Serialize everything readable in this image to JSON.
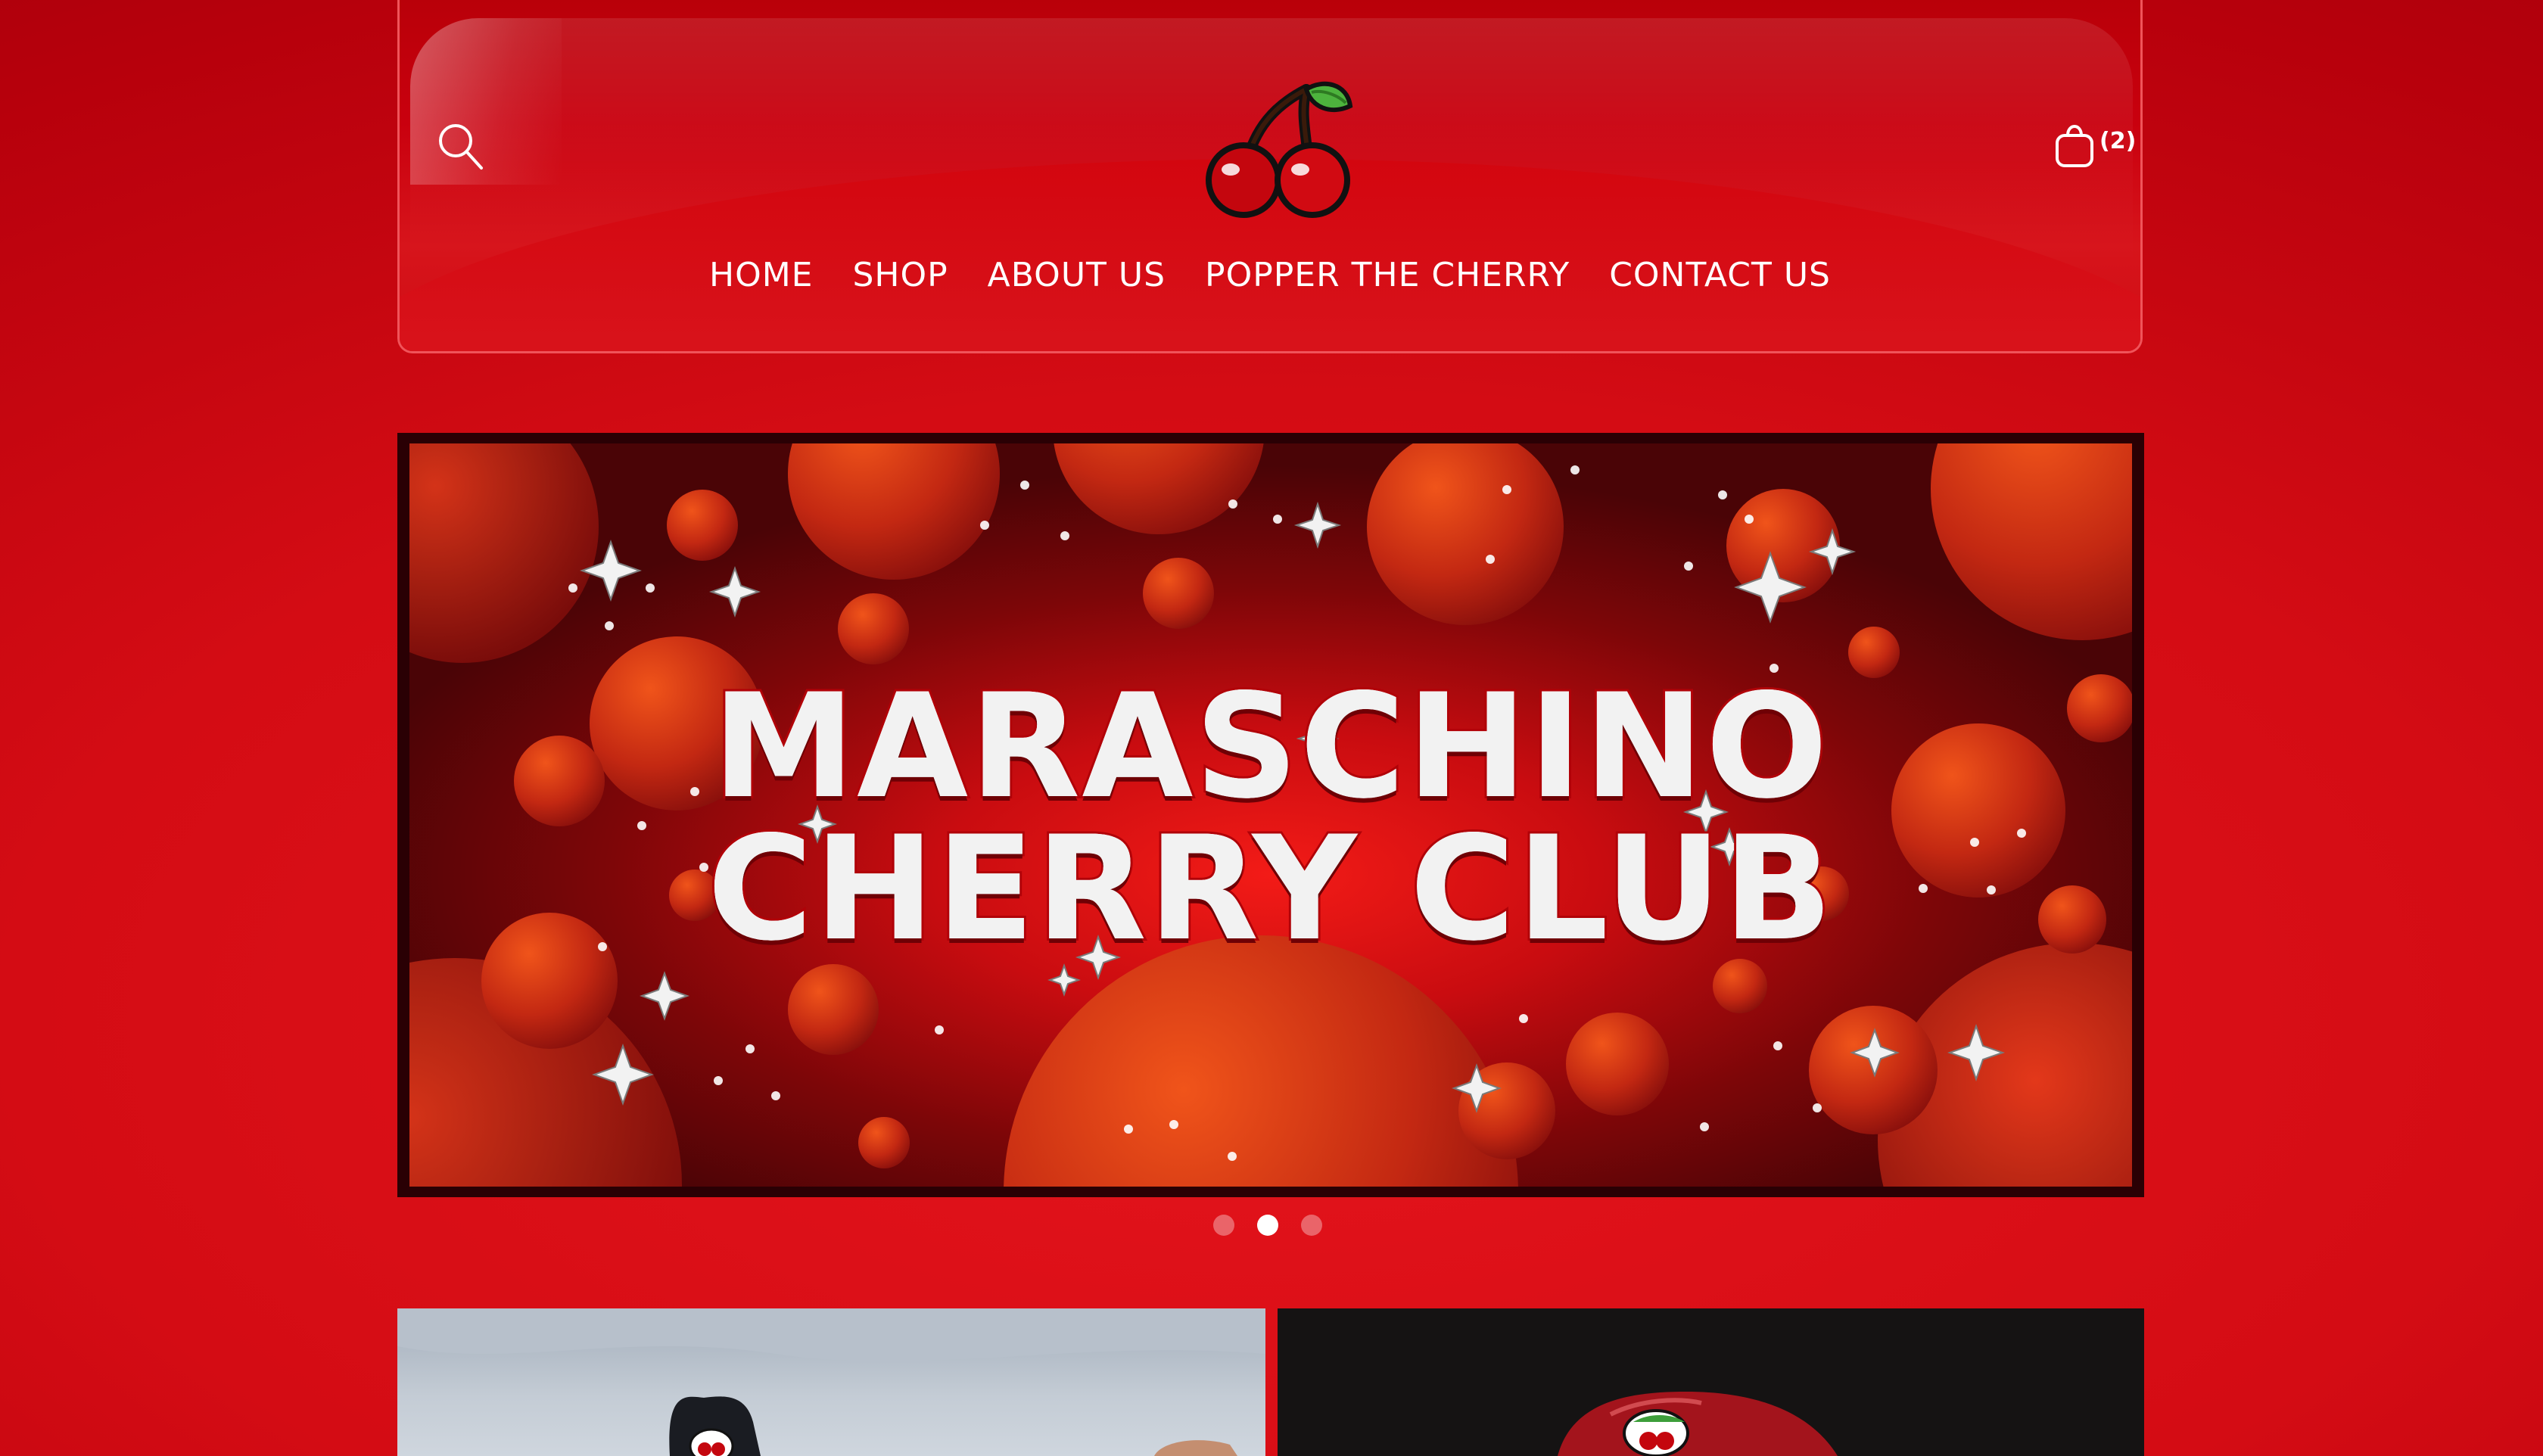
{
  "header": {
    "brand_icon": "cherry-logo",
    "search_icon": "search-icon",
    "cart_icon": "shopping-bag-icon",
    "cart_count": "(2)"
  },
  "nav": {
    "items": [
      {
        "label": "HOME"
      },
      {
        "label": "SHOP"
      },
      {
        "label": "ABOUT US"
      },
      {
        "label": "POPPER THE CHERRY"
      },
      {
        "label": "CONTACT US"
      }
    ]
  },
  "hero": {
    "title_line1": "MARASCHINO",
    "title_line2": "CHERRY CLUB",
    "slide_count": 3,
    "active_slide": 2
  },
  "tiles": [
    {
      "name": "cap-photo-outdoor"
    },
    {
      "name": "red-cap-photo"
    }
  ],
  "colors": {
    "page_bg": "#d40c14",
    "header_border": "#f0545a",
    "hero_frame": "#2a0004",
    "text": "#ffffff"
  }
}
